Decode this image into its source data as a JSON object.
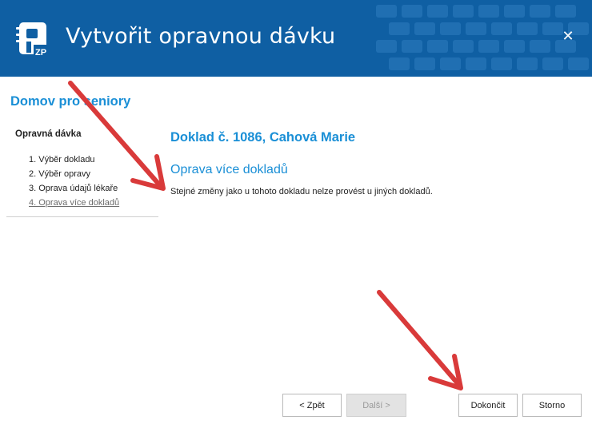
{
  "header": {
    "title": "Vytvořit opravnou dávku",
    "app_icon_label": "ZP",
    "close_symbol": "✕",
    "bg_color": "#0f5fa3"
  },
  "workspace": {
    "title": "Domov pro seniory"
  },
  "navigation": {
    "title": "Opravná dávka",
    "steps": [
      {
        "label": "1. Výběr dokladu"
      },
      {
        "label": "2. Výběr opravy"
      },
      {
        "label": "3. Oprava údajů lékaře"
      },
      {
        "label": "4. Oprava více dokladů"
      }
    ],
    "current_step": 4
  },
  "content": {
    "document_title": "Doklad č. 1086, Cahová Marie",
    "section_title": "Oprava více dokladů",
    "message": "Stejné změny jako u tohoto dokladu nelze provést u jiných dokladů."
  },
  "buttons": {
    "back": "< Zpět",
    "next": "Další >",
    "finish": "Dokončit",
    "cancel": "Storno"
  },
  "colors": {
    "accent": "#1a8fd6",
    "annotation_arrow": "#d93a3a"
  }
}
